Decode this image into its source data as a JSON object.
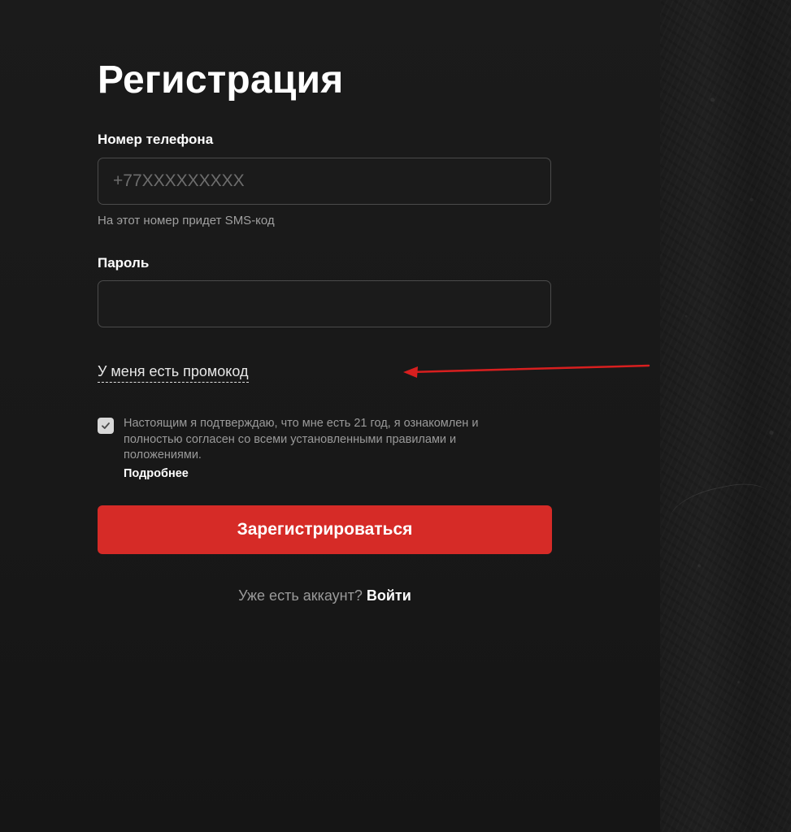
{
  "registration": {
    "title": "Регистрация",
    "phone": {
      "label": "Номер телефона",
      "placeholder": "+77XXXXXXXXX",
      "value": "",
      "hint": "На этот номер придет SMS-код"
    },
    "password": {
      "label": "Пароль",
      "value": ""
    },
    "promo_link": "У меня есть промокод",
    "consent": {
      "checked": true,
      "text": "Настоящим я подтверждаю, что мне есть 21 год, я ознакомлен и полностью согласен со всеми установленными правилами и положениями.",
      "more_link": "Подробнее"
    },
    "submit_label": "Зарегистрироваться",
    "login": {
      "prompt": "Уже есть аккаунт?",
      "link": "Войти"
    }
  },
  "annotation": {
    "arrow_color": "#d81f1f"
  },
  "colors": {
    "background": "#181818",
    "accent": "#d62b27",
    "input_border": "#4b4b4b"
  }
}
